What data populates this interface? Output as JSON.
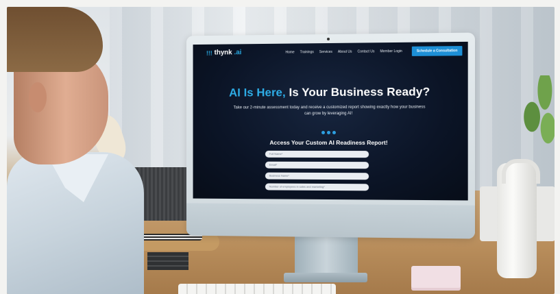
{
  "site": {
    "logo_mark": "!!!",
    "logo_text": "thynk",
    "logo_accent": ".ai",
    "nav": [
      "Home",
      "Trainings",
      "Services",
      "About Us",
      "Contact Us",
      "Member Login"
    ],
    "cta": "Schedule a Consultation",
    "headline_blue": "AI Is Here,",
    "headline_rest": " Is Your Business Ready?",
    "subtext": "Take our 2-minute assessment today and receive a customized report showing exactly how your business can grow by leveraging AI!",
    "form_title": "Access Your Custom AI Readiness Report!",
    "fields": [
      {
        "placeholder": "Full Name*"
      },
      {
        "placeholder": "Email*"
      },
      {
        "placeholder": "Business Name*"
      },
      {
        "placeholder": "Number of employees in sales and marketing*"
      }
    ]
  },
  "colors": {
    "accent": "#29a8e0",
    "cta_bg": "#1d8fd6",
    "screen_bg": "#0b1426"
  }
}
